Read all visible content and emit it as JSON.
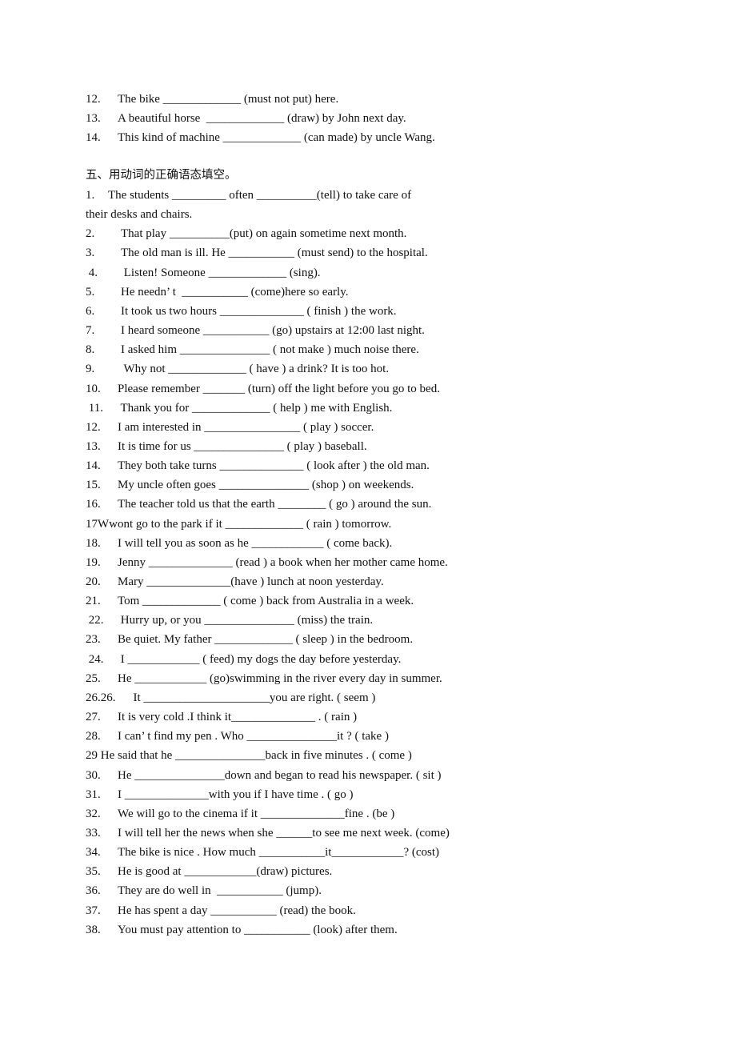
{
  "previous_section_items": [
    {
      "num": "12.",
      "text": "The bike _____________ (must not put) here."
    },
    {
      "num": "13.",
      "text": "A beautiful horse  _____________ (draw) by John next day."
    },
    {
      "num": "14.",
      "text": "This kind of machine _____________ (can made) by uncle Wang."
    }
  ],
  "section": {
    "heading": "五、用动词的正确语态填空。",
    "items": [
      {
        "num": "1.",
        "text": "The students _________ often __________(tell) to take care of"
      },
      {
        "num": "",
        "text": "their desks and chairs."
      },
      {
        "num": "2.",
        "text": "That play __________(put) on again sometime next month."
      },
      {
        "num": "3.",
        "text": "The old man is ill. He ___________ (must send) to the hospital."
      },
      {
        "num": " 4.",
        "text": " Listen! Someone _____________ (sing)."
      },
      {
        "num": "5.",
        "text": "He needn’ t  ___________ (come)here so early."
      },
      {
        "num": "6.",
        "text": "It took us two hours ______________ ( finish ) the work."
      },
      {
        "num": "7.",
        "text": "I heard someone ___________ (go) upstairs at 12:00 last night."
      },
      {
        "num": "8.",
        "text": "I asked him _______________ ( not make ) much noise there."
      },
      {
        "num": "9.",
        "text": " Why not _____________ ( have ) a drink? It is too hot."
      },
      {
        "num": "10.",
        "text": "Please remember _______ (turn) off the light before you go to bed."
      },
      {
        "num": " 11.",
        "text": " Thank you for _____________ ( help ) me with English."
      },
      {
        "num": "12.",
        "text": "I am interested in ________________ ( play ) soccer."
      },
      {
        "num": "13.",
        "text": "It is time for us _______________ ( play ) baseball."
      },
      {
        "num": "14.",
        "text": "They both take turns ______________ ( look after ) the old man."
      },
      {
        "num": "15.",
        "text": "My uncle often goes _______________ (shop ) on weekends."
      },
      {
        "num": "16.",
        "text": "The teacher told us that the earth ________ ( go ) around the sun."
      },
      {
        "num": "",
        "text": "17Wwont go to the park if it _____________ ( rain ) tomorrow."
      },
      {
        "num": "18.",
        "text": "I will tell you as soon as he ____________ ( come back)."
      },
      {
        "num": "19.",
        "text": "Jenny ______________ (read ) a book when her mother came home."
      },
      {
        "num": "20.",
        "text": "Mary ______________(have ) lunch at noon yesterday."
      },
      {
        "num": "21.",
        "text": "Tom _____________ ( come ) back from Australia in a week."
      },
      {
        "num": " 22.",
        "text": " Hurry up, or you _______________ (miss) the train."
      },
      {
        "num": "23.",
        "text": "Be quiet. My father _____________ ( sleep ) in the bedroom."
      },
      {
        "num": " 24.",
        "text": " I ____________ ( feed) my dogs the day before yesterday."
      },
      {
        "num": "25.",
        "text": "He ____________ (go)swimming in the river every day in summer."
      },
      {
        "num": "26.26.",
        "text": "  It _____________________you are right. ( seem )"
      },
      {
        "num": "27.",
        "text": "It is very cold .I think it______________ . ( rain )"
      },
      {
        "num": "28.",
        "text": "I can’ t find my pen . Who _______________it ? ( take )"
      },
      {
        "num": "",
        "text": "29 He said that he _______________back in five minutes . ( come )"
      },
      {
        "num": "30.",
        "text": "He _______________down and began to read his newspaper. ( sit )"
      },
      {
        "num": "31.",
        "text": "I ______________with you if I have time . ( go )"
      },
      {
        "num": "32.",
        "text": "We will go to the cinema if it ______________fine . (be )"
      },
      {
        "num": "33.",
        "text": "I will tell her the news when she ______to see me next week. (come)"
      },
      {
        "num": "34.",
        "text": "The bike is nice . How much ___________it____________? (cost)"
      },
      {
        "num": "35.",
        "text": "He is good at ____________(draw) pictures."
      },
      {
        "num": "36.",
        "text": "They are do well in  ___________ (jump)."
      },
      {
        "num": "37.",
        "text": "He has spent a day ___________ (read) the book."
      },
      {
        "num": "38.",
        "text": "You must pay attention to ___________ (look) after them."
      }
    ]
  }
}
